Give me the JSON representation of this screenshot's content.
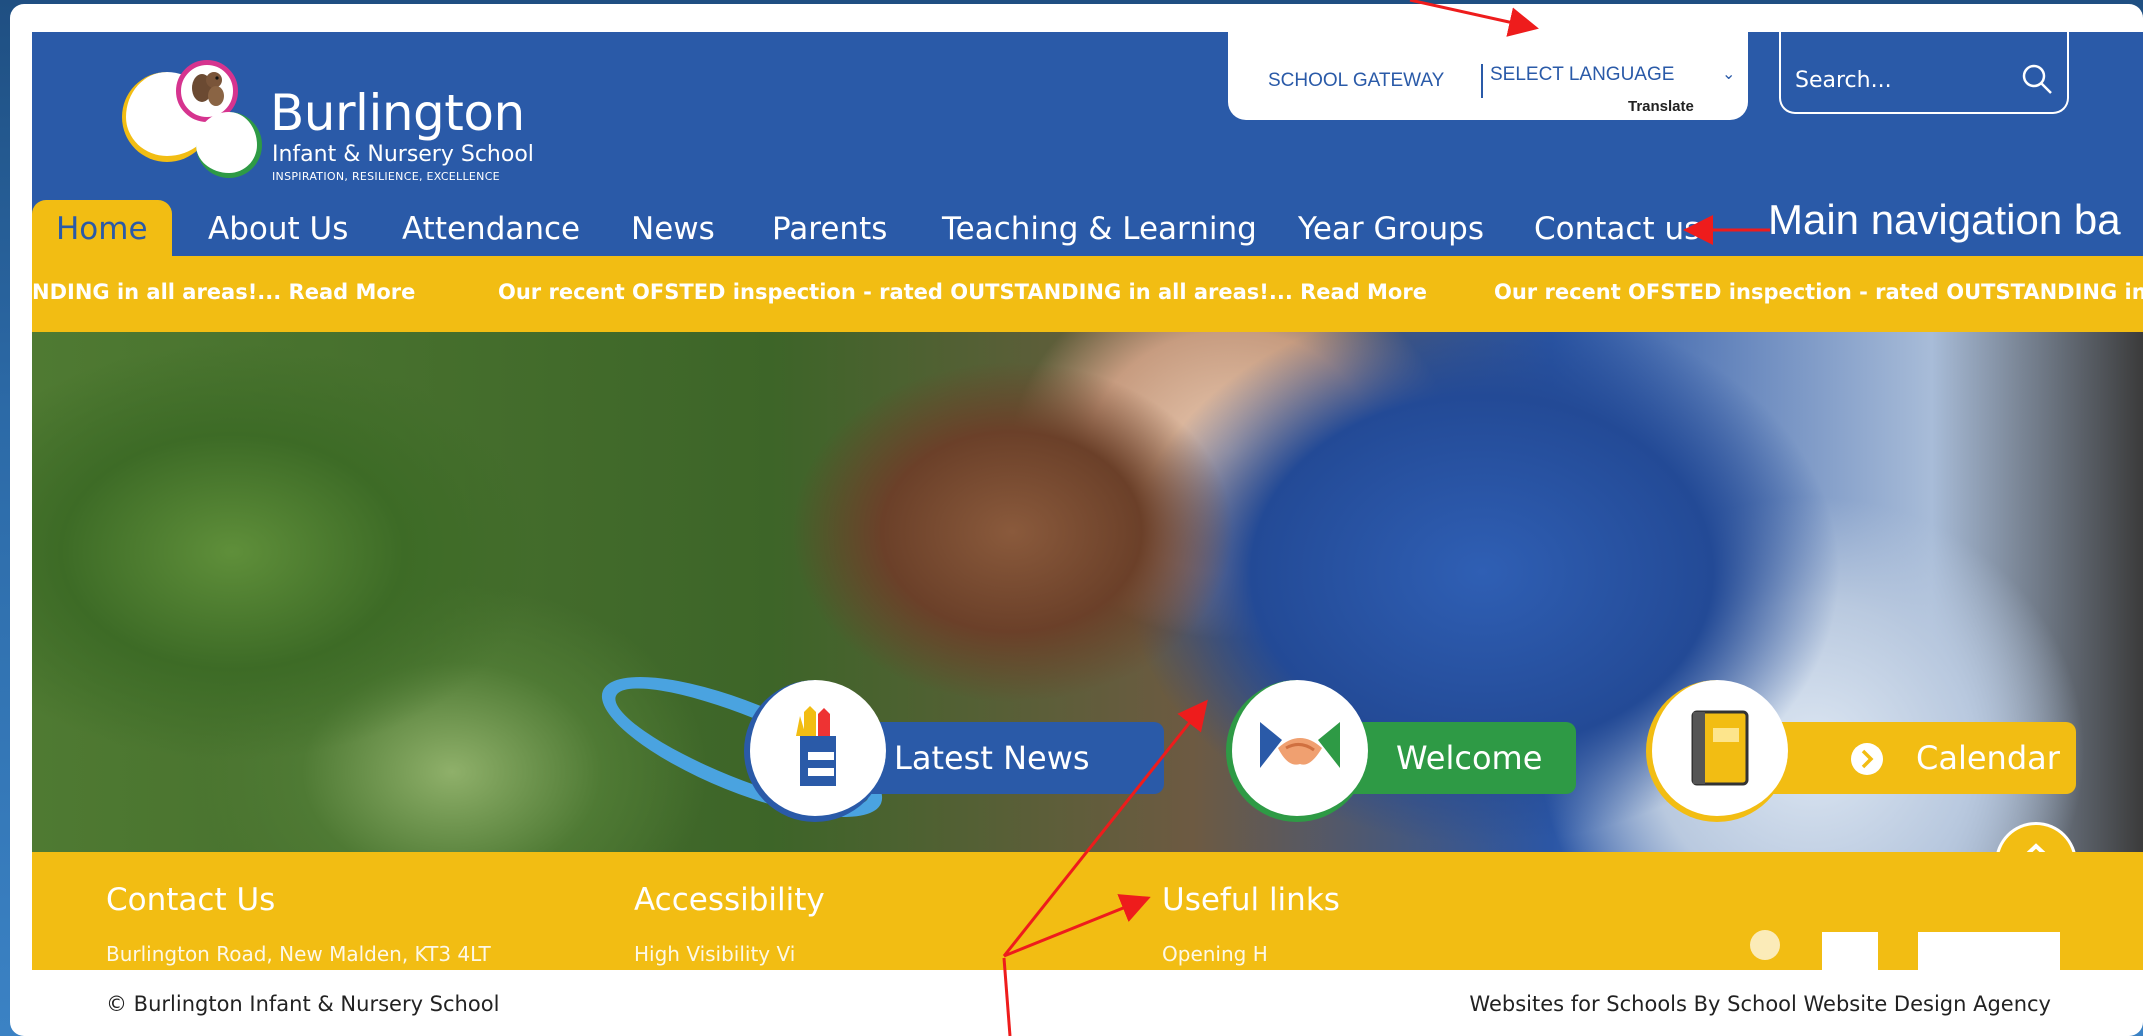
{
  "brand": {
    "name": "Burlington",
    "subtitle": "Infant & Nursery School",
    "motto": "INSPIRATION, RESILIENCE, EXCELLENCE"
  },
  "topbar": {
    "gateway": "SCHOOL GATEWAY",
    "language": "SELECT LANGUAGE",
    "translate": "Translate"
  },
  "search": {
    "placeholder": "Search..."
  },
  "nav": {
    "items": [
      {
        "label": "Home",
        "active": true
      },
      {
        "label": "About Us"
      },
      {
        "label": "Attendance"
      },
      {
        "label": "News"
      },
      {
        "label": "Parents"
      },
      {
        "label": "Teaching & Learning"
      },
      {
        "label": "Year Groups"
      },
      {
        "label": "Contact us"
      }
    ]
  },
  "ticker": {
    "items": [
      "NDING in all areas!... Read More",
      "Our recent OFSTED inspection - rated OUTSTANDING in all areas!... Read More",
      "Our recent OFSTED inspection - rated OUTSTANDING in"
    ]
  },
  "quicklinks": [
    {
      "label": "Latest News",
      "icon": "pencil-pot-icon",
      "color": "#2a5aa8"
    },
    {
      "label": "Welcome",
      "icon": "handshake-icon",
      "color": "#2e9a45"
    },
    {
      "label": "Calendar",
      "icon": "book-icon",
      "color": "#f2bd13"
    }
  ],
  "footer": {
    "headings": [
      "Contact Us",
      "Accessibility",
      "Useful links"
    ],
    "cut_text": [
      "Burlington Road, New Malden, KT3 4LT",
      "High Visibility Vi",
      "Opening H"
    ]
  },
  "bottom": {
    "copyright": "© Burlington Infant & Nursery School",
    "credit": "Websites for Schools By School Website Design Agency"
  },
  "annotations": {
    "nav_label": "Main navigation ba"
  },
  "colors": {
    "primary_blue": "#2a5aa8",
    "accent_yellow": "#f2bd13",
    "welcome_green": "#2e9a45",
    "annotation_red": "#ee1c1c"
  }
}
